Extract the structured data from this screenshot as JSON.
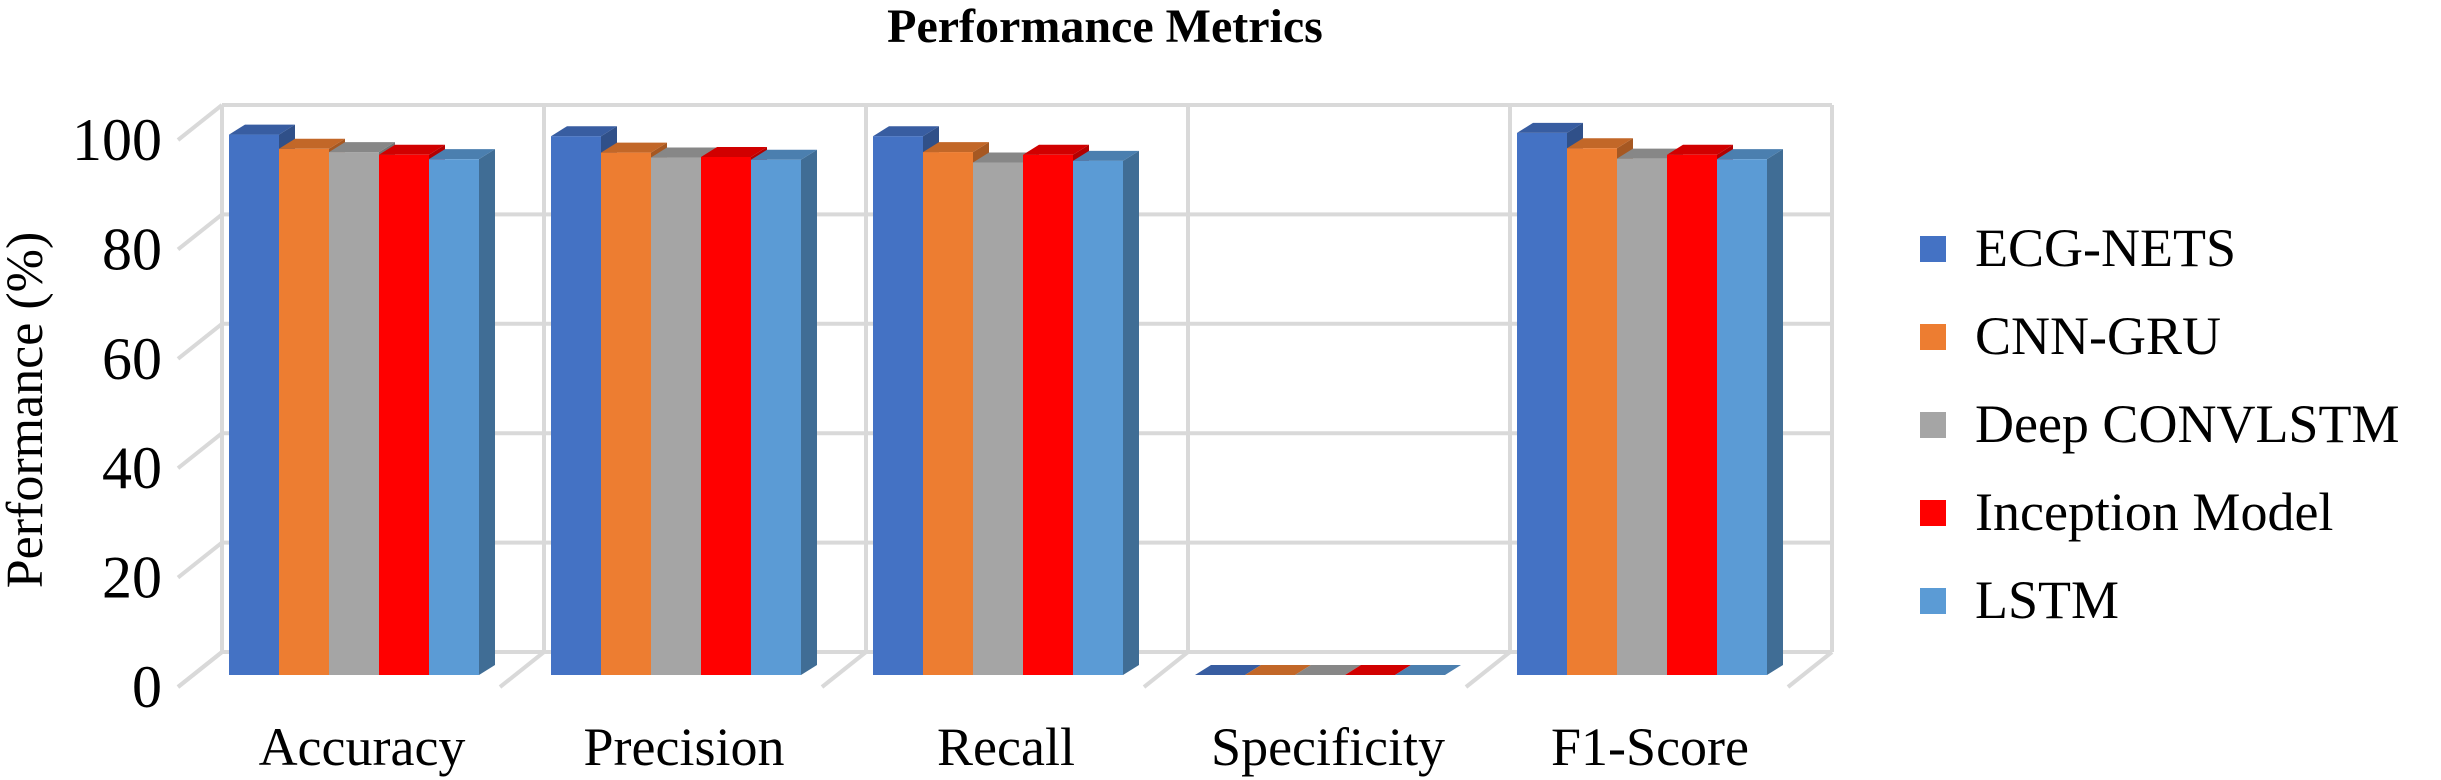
{
  "chart_data": {
    "type": "bar",
    "style": "3d-clustered-column",
    "title": "Performance Metrics",
    "xlabel": "",
    "ylabel": "Performance (%)",
    "ylim": [
      0,
      100
    ],
    "yticks": [
      0,
      20,
      40,
      60,
      80,
      100
    ],
    "grid": true,
    "legend_position": "right",
    "categories": [
      "Accuracy",
      "Precision",
      "Recall",
      "Specificity",
      "F1-Score"
    ],
    "series": [
      {
        "name": "ECG-NETS",
        "color": "#4472C4",
        "values": [
          98.8,
          98.5,
          98.5,
          0,
          99.1
        ]
      },
      {
        "name": "CNN-GRU",
        "color": "#ED7D31",
        "values": [
          96.2,
          95.5,
          95.6,
          0,
          96.3
        ]
      },
      {
        "name": "Deep CONVLSTM",
        "color": "#A5A5A5",
        "values": [
          95.6,
          94.6,
          93.7,
          0,
          94.4
        ]
      },
      {
        "name": "Inception Model",
        "color": "#FF0000",
        "values": [
          95.1,
          94.7,
          95.1,
          0,
          95.1
        ]
      },
      {
        "name": "LSTM",
        "color": "#5B9BD5",
        "values": [
          94.3,
          94.2,
          94.0,
          0,
          94.3
        ]
      }
    ]
  }
}
